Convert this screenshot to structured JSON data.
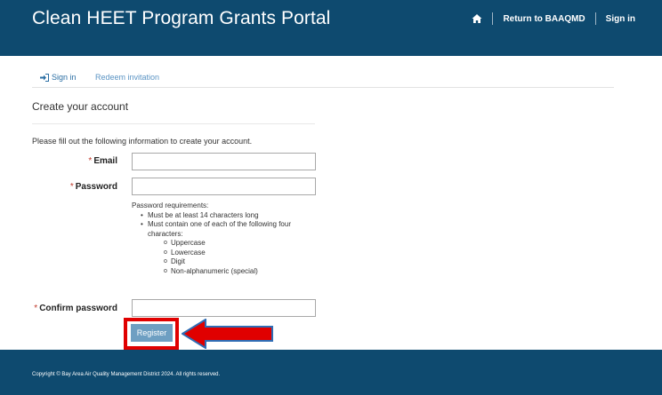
{
  "header": {
    "title": "Clean HEET Program Grants Portal",
    "home_icon": "home-icon",
    "return_link": "Return to BAAQMD",
    "signin_link": "Sign in",
    "background_color": "#0e4a6f"
  },
  "tabs": {
    "signin_label": "Sign in",
    "signin_icon": "sign-in-icon",
    "redeem_label": "Redeem invitation"
  },
  "form": {
    "section_title": "Create your account",
    "intro": "Please fill out the following information to create your account.",
    "required_marker": "*",
    "email_label": "Email",
    "email_value": "",
    "password_label": "Password",
    "password_value": "",
    "requirements": {
      "heading": "Password requirements:",
      "items": [
        "Must be at least 14 characters long",
        "Must contain one of each of the following four characters:"
      ],
      "subitems": [
        "Uppercase",
        "Lowercase",
        "Digit",
        "Non-alphanumeric (special)"
      ]
    },
    "confirm_label": "Confirm password",
    "confirm_value": "",
    "register_label": "Register",
    "highlight_color": "#e00000",
    "arrow_color": "#e00000"
  },
  "footer": {
    "copyright": "Copyright © Bay Area Air Quality Management District 2024. All rights reserved."
  }
}
